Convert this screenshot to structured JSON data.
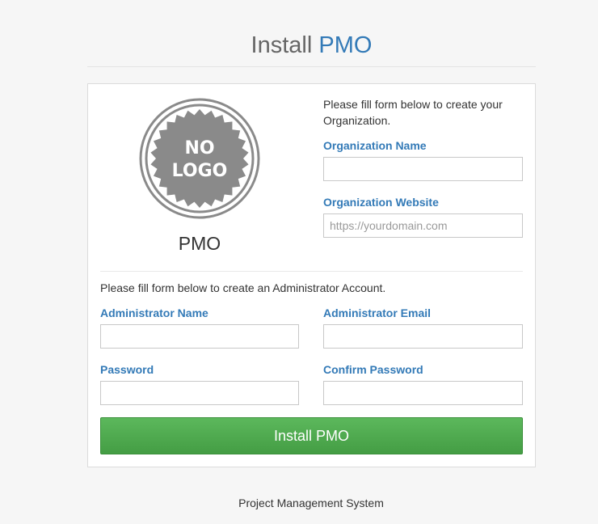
{
  "header": {
    "title_prefix": "Install",
    "title_accent": "PMO"
  },
  "logo": {
    "line1": "NO",
    "line2": "LOGO",
    "icon": "no-logo-badge-icon"
  },
  "org_display_name": "PMO",
  "org_section": {
    "intro": "Please fill form below to create your Organization.",
    "org_name_label": "Organization Name",
    "org_name_value": "",
    "org_website_label": "Organization Website",
    "org_website_placeholder": "https://yourdomain.com",
    "org_website_value": ""
  },
  "admin_section": {
    "intro": "Please fill form below to create an Administrator Account.",
    "admin_name_label": "Administrator Name",
    "admin_email_label": "Administrator Email",
    "password_label": "Password",
    "confirm_password_label": "Confirm Password"
  },
  "submit_label": "Install PMO",
  "footer_text": "Project Management System",
  "colors": {
    "accent": "#337ab7",
    "submit_green": "#5cb85c",
    "background": "#f6f6f6"
  }
}
